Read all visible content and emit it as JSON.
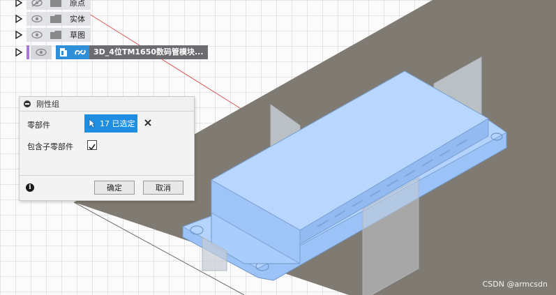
{
  "browser": {
    "items": [
      {
        "label": "原点",
        "expanded": false
      },
      {
        "label": "实体",
        "expanded": false
      },
      {
        "label": "草图",
        "expanded": false
      }
    ],
    "component": {
      "label": "3D_4位TM1650数码管模块...",
      "marker_color": "#a878d8"
    }
  },
  "dialog": {
    "title": "刚性组",
    "components_label": "零部件",
    "selection_text": "17 已选定",
    "include_children_label": "包含子零部件",
    "include_children_checked": true,
    "ok_label": "确定",
    "cancel_label": "取消"
  },
  "colors": {
    "accent": "#1f8ee0",
    "selected_body": "#a9cdfc",
    "ground_plane": "#807b72"
  },
  "watermark": "CSDN @armcsdn"
}
